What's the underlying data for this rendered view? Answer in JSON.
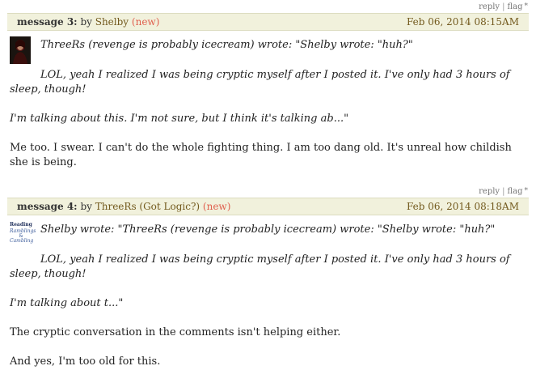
{
  "actions": {
    "reply": "reply",
    "separator": "|",
    "flag": "flag",
    "flag_marker": "*"
  },
  "messages": [
    {
      "label": "message 3:",
      "by": "by",
      "author": "Shelby",
      "new_badge": "(new)",
      "date": "Feb 06, 2014 08:15AM",
      "avatar": "dark-portrait-avatar",
      "paragraphs": [
        "ThreeRs (revenge is probably icecream) wrote: \"Shelby wrote: \"huh?\"",
        "LOL, yeah I realized I was being cryptic myself after I posted it. I've only had 3 hours of sleep, though!",
        "I'm talking about this. I'm not sure, but I think it's talking ab...\"",
        "Me too. I swear. I can't do the whole fighting thing. I am too dang old. It's unreal how childish she is being."
      ]
    },
    {
      "label": "message 4:",
      "by": "by",
      "author": "ThreeRs (Got Logic?)",
      "new_badge": "(new)",
      "date": "Feb 06, 2014 08:18AM",
      "avatar": "reading-rambling-avatar",
      "avatar_text": [
        "Reading",
        "Ramblings",
        "&",
        "Cambling"
      ],
      "paragraphs": [
        "Shelby wrote: \"ThreeRs (revenge is probably icecream) wrote: \"Shelby wrote: \"huh?\"",
        "LOL, yeah I realized I was being cryptic myself after I posted it. I've only had 3 hours of sleep, though!",
        "I'm talking about t...\"",
        "The cryptic conversation in the comments isn't helping either.",
        "And yes, I'm too old for this."
      ]
    }
  ],
  "colors": {
    "header_bg": "#f1f1dc",
    "author": "#735a1e",
    "new_badge": "#e0604f",
    "text": "#222222"
  }
}
